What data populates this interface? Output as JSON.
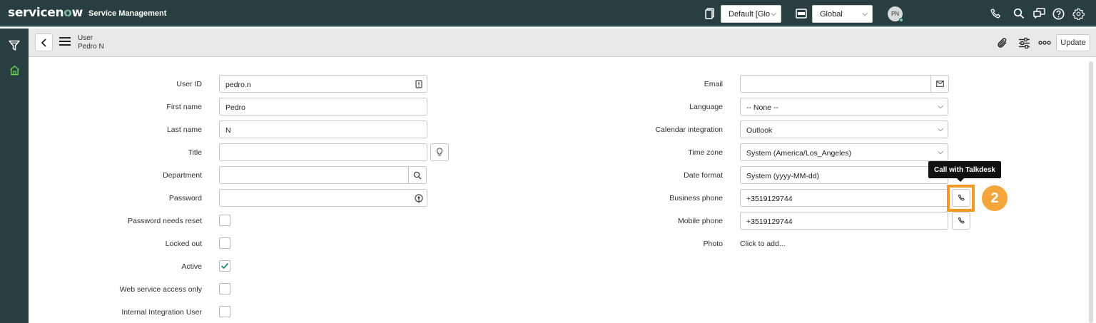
{
  "header": {
    "logo": {
      "prefix": "servicen",
      "o": "o",
      "suffix": "w"
    },
    "product": "Service Management",
    "update_set": "Default [Glo",
    "application_scope": "Global",
    "avatar_initials": "PN"
  },
  "form_header": {
    "record_type": "User",
    "record_name": "Pedro N",
    "update_label": "Update"
  },
  "fields_left": {
    "user_id": {
      "label": "User ID",
      "value": "pedro.n"
    },
    "first_name": {
      "label": "First name",
      "value": "Pedro"
    },
    "last_name": {
      "label": "Last name",
      "value": "N"
    },
    "title": {
      "label": "Title",
      "value": ""
    },
    "department": {
      "label": "Department",
      "value": ""
    },
    "password": {
      "label": "Password",
      "value": ""
    },
    "password_needs_reset": {
      "label": "Password needs reset",
      "checked": false
    },
    "locked_out": {
      "label": "Locked out",
      "checked": false
    },
    "active": {
      "label": "Active",
      "checked": true
    },
    "web_service_access_only": {
      "label": "Web service access only",
      "checked": false
    },
    "internal_integration_user": {
      "label": "Internal Integration User",
      "checked": false
    }
  },
  "fields_right": {
    "email": {
      "label": "Email",
      "value": ""
    },
    "language": {
      "label": "Language",
      "value": "-- None --"
    },
    "calendar_integration": {
      "label": "Calendar integration",
      "value": "Outlook"
    },
    "time_zone": {
      "label": "Time zone",
      "value": "System (America/Los_Angeles)"
    },
    "date_format": {
      "label": "Date format",
      "value": "System (yyyy-MM-dd)"
    },
    "business_phone": {
      "label": "Business phone",
      "value": "+3519129744"
    },
    "mobile_phone": {
      "label": "Mobile phone",
      "value": "+3519129744"
    },
    "photo": {
      "label": "Photo",
      "value": "Click to add..."
    }
  },
  "tooltip": "Call with Talkdesk",
  "step_marker": "2",
  "colors": {
    "header_bg": "#293e40",
    "form_header_bg": "#e7e9eb",
    "highlight": "#f39a24",
    "step_badge": "#f4a63a",
    "check": "#278efc"
  }
}
